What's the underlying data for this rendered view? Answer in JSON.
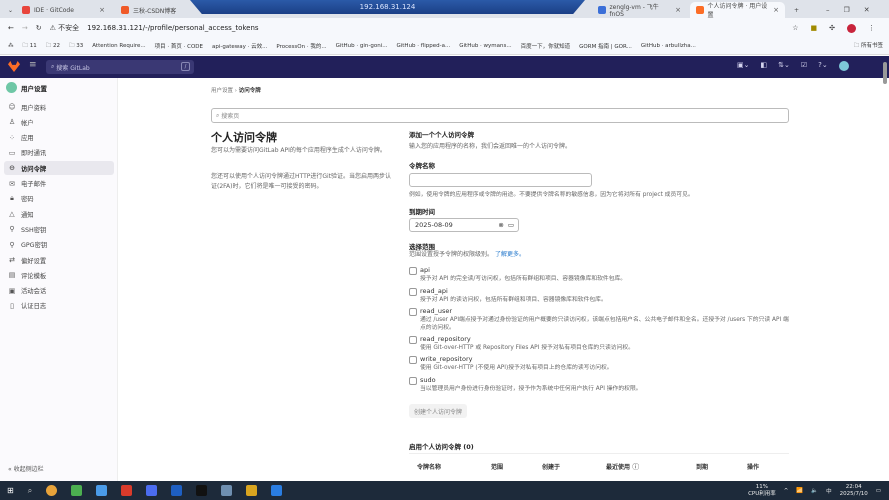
{
  "browser": {
    "tabs": [
      {
        "title": "IDE · GitCode",
        "color": "#e8453c"
      },
      {
        "title": "三秋-CSDN博客",
        "color": "#f05a28"
      },
      {
        "title": "zenglg-vm - 飞牛 fnOS",
        "color": "#3b6fd8"
      },
      {
        "title": "个人访问令牌 · 用户设置",
        "color": "#fc6d26"
      }
    ],
    "remote_host": "192.168.31.124",
    "insecure_label": "不安全",
    "url": "192.168.31.121/-/profile/personal_access_tokens",
    "bookmarks": [
      "11",
      "22",
      "33",
      "Attention Require...",
      "项目 · 首页 · CODE",
      "api-gateway · 云效...",
      "ProcessOn · 我的...",
      "GitHub · gin-goni...",
      "GitHub · flipped-a...",
      "GitHub · wymans...",
      "百度一下，你就知道",
      "GORM 指南 | GOR...",
      "GitHub · arbullzha..."
    ],
    "all_bookmarks": "所有书签"
  },
  "gitlab": {
    "search_placeholder": "搜索 GitLab",
    "search_shortcut": "/",
    "accent": "#22205a"
  },
  "sidebar": {
    "title": "用户设置",
    "items": [
      {
        "label": "用户资料",
        "icon": "profile-icon"
      },
      {
        "label": "帐户",
        "icon": "account-icon"
      },
      {
        "label": "应用",
        "icon": "applications-icon"
      },
      {
        "label": "即时通讯",
        "icon": "chat-icon"
      },
      {
        "label": "访问令牌",
        "icon": "token-icon",
        "active": true
      },
      {
        "label": "电子邮件",
        "icon": "mail-icon"
      },
      {
        "label": "密码",
        "icon": "lock-icon"
      },
      {
        "label": "通知",
        "icon": "bell-icon"
      },
      {
        "label": "SSH密钥",
        "icon": "key-icon"
      },
      {
        "label": "GPG密钥",
        "icon": "key-icon"
      },
      {
        "label": "偏好设置",
        "icon": "preferences-icon"
      },
      {
        "label": "评论模板",
        "icon": "comment-icon"
      },
      {
        "label": "活动会话",
        "icon": "monitor-icon"
      },
      {
        "label": "认证日志",
        "icon": "log-icon"
      }
    ],
    "collapse": "收起侧边栏"
  },
  "main": {
    "breadcrumb": [
      "用户设置",
      "访问令牌"
    ],
    "search_placeholder": "搜索页",
    "title": "个人访问令牌",
    "intro1": "您可以为需要访问GitLab API的每个应用程序生成个人访问令牌。",
    "intro2": "您还可以使用个人访问令牌通过HTTP进行Git验证。当您启用两步认证(2FA)时，它们将是唯一可接受的密码。",
    "form": {
      "heading": "添加一个个人访问令牌",
      "desc": "输入您的应用程序的名称，我们会返回唯一的个人访问令牌。",
      "name_label": "令牌名称",
      "name_value": "",
      "name_help": "例如，使用令牌的应用程序或令牌的用途。不要提供令牌名称的敏感信息，因为它将对所有 project 成员可见。",
      "expiry_label": "到期时间",
      "expiry_value": "2025-08-09",
      "scopes_label": "选择范围",
      "scopes_desc": "范围设置授予令牌的权限级别。",
      "learn_more": "了解更多。",
      "scopes": [
        {
          "name": "api",
          "desc": "授予对 API 的完全读/写访问权，包括所有群组和项目、容器镜像库和软件包库。",
          "checked": false
        },
        {
          "name": "read_api",
          "desc": "授予对 API 的读访问权，包括所有群组和项目、容器镜像库和软件包库。",
          "checked": false
        },
        {
          "name": "read_user",
          "desc": "通过 /user API端点授予对通过身份验证的用户概要的只读访问权，该端点包括用户名、公共电子邮件和全名。还授予对 /users 下的只读 API 端点的访问权。",
          "checked": false
        },
        {
          "name": "read_repository",
          "desc": "使用 Git-over-HTTP 或 Repository Files API 授予对私有项目仓库的只读访问权。",
          "checked": false
        },
        {
          "name": "write_repository",
          "desc": "使用 Git-over-HTTP (不使用 API)授予对私有项目上的仓库的读写访问权。",
          "checked": false
        },
        {
          "name": "sudo",
          "desc": "当以管理员用户身份进行身份验证时，授予作为系统中任何用户执行 API 操作的权限。",
          "checked": false
        }
      ],
      "submit": "创建个人访问令牌"
    },
    "active_heading": "启用个人访问令牌 (0)",
    "table_headers": [
      "令牌名称",
      "范围",
      "创建于",
      "最近使用",
      "到期",
      "操作"
    ]
  },
  "taskbar": {
    "cpu": "11%",
    "cpu_label": "CPU利用率",
    "ime": "中",
    "time": "22:04",
    "date": "2025/7/10"
  }
}
